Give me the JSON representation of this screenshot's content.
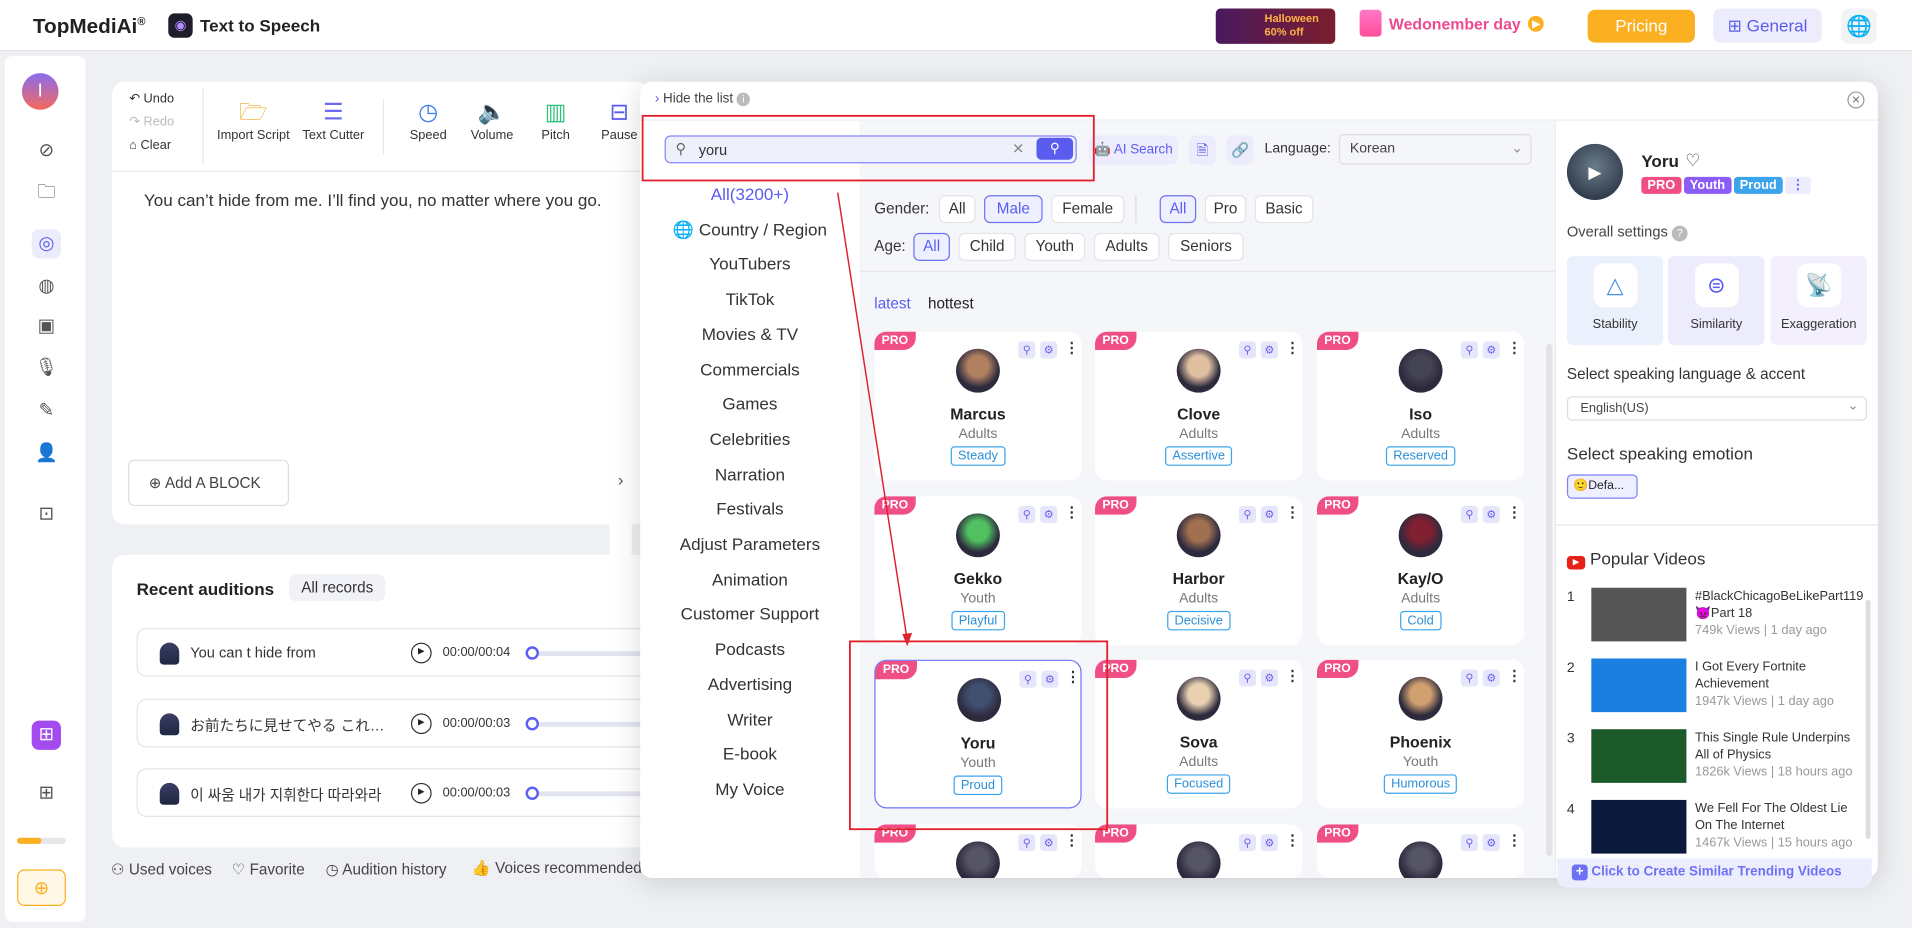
{
  "header": {
    "logo": "TopMediAi",
    "logo_suffix": "®",
    "app_title": "Text to Speech",
    "promo_banner": "Halloween 60% off",
    "promo_text": "Wedonember day",
    "pricing": "Pricing",
    "general": "General"
  },
  "toolbar": {
    "undo": "Undo",
    "redo": "Redo",
    "clear": "Clear",
    "import_script": "Import Script",
    "text_cutter": "Text Cutter",
    "speed": "Speed",
    "volume": "Volume",
    "pitch": "Pitch",
    "pause": "Pause"
  },
  "editor": {
    "text": "You can’t hide from me. I’ll find you, no matter where you go.",
    "add_block": "Add A BLOCK"
  },
  "auditions": {
    "title": "Recent auditions",
    "all_records": "All records",
    "rows": [
      {
        "text": "You can t hide from",
        "time": "00:00/00:04"
      },
      {
        "text": "お前たちに見せてやる これが...",
        "time": "00:00/00:03"
      },
      {
        "text": "이 싸움 내가 지휘한다 따라와라",
        "time": "00:00/00:03"
      }
    ]
  },
  "footer_links": [
    "Used voices",
    "Favorite",
    "Audition history",
    "Voices recommended"
  ],
  "modal": {
    "hide_list": "Hide the list",
    "search": {
      "value": "yoru",
      "ai_search": "AI Search"
    },
    "language_label": "Language:",
    "language_value": "Korean",
    "categories": [
      "All(3200+)",
      "Country / Region",
      "YouTubers",
      "TikTok",
      "Movies & TV",
      "Commercials",
      "Games",
      "Celebrities",
      "Narration",
      "Festivals",
      "Adjust Parameters",
      "Animation",
      "Customer Support",
      "Podcasts",
      "Advertising",
      "Writer",
      "E-book",
      "My Voice"
    ],
    "gender_label": "Gender:",
    "gender": [
      "All",
      "Male",
      "Female"
    ],
    "gender_selected": "Male",
    "tier": [
      "All",
      "Pro",
      "Basic"
    ],
    "tier_selected": "All",
    "age_label": "Age:",
    "age": [
      "All",
      "Child",
      "Youth",
      "Adults",
      "Seniors"
    ],
    "age_selected": "All",
    "sort": [
      "latest",
      "hottest"
    ],
    "sort_selected": "latest",
    "pro_label": "PRO",
    "voices": [
      {
        "name": "Marcus",
        "age": "Adults",
        "tag": "Steady"
      },
      {
        "name": "Clove",
        "age": "Adults",
        "tag": "Assertive"
      },
      {
        "name": "Iso",
        "age": "Adults",
        "tag": "Reserved"
      },
      {
        "name": "Gekko",
        "age": "Youth",
        "tag": "Playful"
      },
      {
        "name": "Harbor",
        "age": "Adults",
        "tag": "Decisive"
      },
      {
        "name": "Kay/O",
        "age": "Adults",
        "tag": "Cold"
      },
      {
        "name": "Yoru",
        "age": "Youth",
        "tag": "Proud",
        "selected": true
      },
      {
        "name": "Sova",
        "age": "Adults",
        "tag": "Focused"
      },
      {
        "name": "Phoenix",
        "age": "Youth",
        "tag": "Humorous"
      }
    ]
  },
  "detail": {
    "name": "Yoru",
    "badges": [
      "PRO",
      "Youth",
      "Proud"
    ],
    "overall_settings": "Overall settings",
    "settings": [
      "Stability",
      "Similarity",
      "Exaggeration"
    ],
    "lang_label": "Select speaking language & accent",
    "lang_value": "English(US)",
    "emotion_label": "Select speaking emotion",
    "emotion_value": "Defa...",
    "popular_title": "Popular Videos",
    "videos": [
      {
        "rank": "1",
        "title": "#BlackChicagoBeLikePart119 👿Part 18",
        "meta": "749k Views | 1 day ago"
      },
      {
        "rank": "2",
        "title": "I Got Every Fortnite Achievement",
        "meta": "1947k Views | 1 day ago"
      },
      {
        "rank": "3",
        "title": "This Single Rule Underpins All of Physics",
        "meta": "1826k Views | 18 hours ago"
      },
      {
        "rank": "4",
        "title": "We Fell For The Oldest Lie On The Internet",
        "meta": "1467k Views | 15 hours ago"
      }
    ],
    "create_similar": "Click to Create Similar Trending Videos"
  },
  "colors": {
    "accent": "#5a5cf0",
    "pricing": "#fbb021",
    "pro": "#f04f86",
    "annotation": "#e0212b"
  }
}
